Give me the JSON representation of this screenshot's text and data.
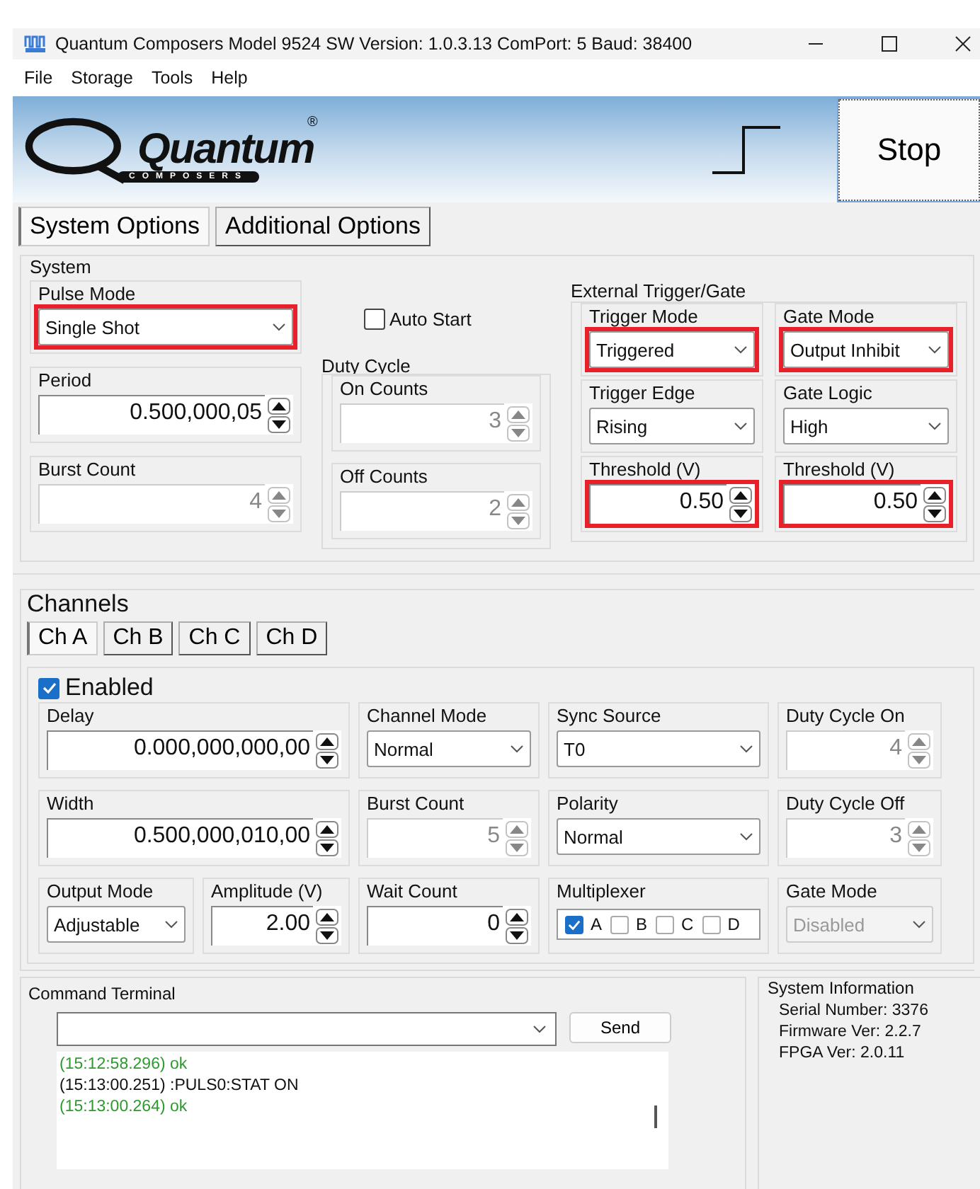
{
  "window": {
    "title": "Quantum Composers Model 9524  SW Version: 1.0.3.13 ComPort: 5 Baud: 38400"
  },
  "menu": [
    {
      "label": "File"
    },
    {
      "label": "Storage"
    },
    {
      "label": "Tools"
    },
    {
      "label": "Help"
    }
  ],
  "banner": {
    "logo": "Quantum",
    "logo_mark": "®",
    "logo_sub": "COMPOSERS",
    "stop_button": "Stop"
  },
  "tabs": [
    {
      "label": "System Options",
      "selected": true
    },
    {
      "label": "Additional Options",
      "selected": false
    }
  ],
  "system": {
    "title": "System",
    "left": [
      {
        "label": "Pulse Mode",
        "kind": "select",
        "value": "Single Shot",
        "disabled": false,
        "highlighted": true
      },
      {
        "label": "Period",
        "kind": "spin",
        "value": "0.500,000,05",
        "disabled": false,
        "highlighted": false
      },
      {
        "label": "Burst Count",
        "kind": "spin",
        "value": "4",
        "disabled": true,
        "highlighted": false
      }
    ],
    "auto_start": {
      "label": "Auto Start",
      "checked": false
    },
    "duty_cycle": {
      "title": "Duty Cycle",
      "fields": [
        {
          "label": "On Counts",
          "kind": "spin",
          "value": "3",
          "disabled": true,
          "highlighted": false
        },
        {
          "label": "Off Counts",
          "kind": "spin",
          "value": "2",
          "disabled": true,
          "highlighted": false
        }
      ]
    },
    "external": {
      "title": "External Trigger/Gate",
      "fields": [
        {
          "label": "Trigger Mode",
          "kind": "select",
          "value": "Triggered",
          "disabled": false,
          "highlighted": true
        },
        {
          "label": "Gate Mode",
          "kind": "select",
          "value": "Output Inhibit",
          "disabled": false,
          "highlighted": true
        },
        {
          "label": "Trigger Edge",
          "kind": "select",
          "value": "Rising",
          "disabled": false,
          "highlighted": false
        },
        {
          "label": "Gate Logic",
          "kind": "select",
          "value": "High",
          "disabled": false,
          "highlighted": false
        },
        {
          "label": "Threshold (V)",
          "kind": "spin",
          "value": "0.50",
          "disabled": false,
          "highlighted": true
        },
        {
          "label": "Threshold (V)",
          "kind": "spin",
          "value": "0.50",
          "disabled": false,
          "highlighted": true
        }
      ]
    }
  },
  "channels": {
    "title": "Channels",
    "tabs": [
      {
        "label": "Ch A",
        "selected": true
      },
      {
        "label": "Ch B",
        "selected": false
      },
      {
        "label": "Ch C",
        "selected": false
      },
      {
        "label": "Ch D",
        "selected": false
      }
    ],
    "enabled": {
      "label": "Enabled",
      "checked": true
    },
    "fields": [
      {
        "label": "Delay",
        "kind": "spin",
        "value": "0.000,000,000,00",
        "disabled": false,
        "highlighted": false
      },
      {
        "label": "Channel Mode",
        "kind": "select",
        "value": "Normal",
        "disabled": false,
        "highlighted": false
      },
      {
        "label": "Sync Source",
        "kind": "select",
        "value": "T0",
        "disabled": false,
        "highlighted": false
      },
      {
        "label": "Duty Cycle On",
        "kind": "spin",
        "value": "4",
        "disabled": true,
        "highlighted": false
      },
      {
        "label": "Width",
        "kind": "spin",
        "value": "0.500,000,010,00",
        "disabled": false,
        "highlighted": false
      },
      {
        "label": "Burst Count",
        "kind": "spin",
        "value": "5",
        "disabled": true,
        "highlighted": false
      },
      {
        "label": "Polarity",
        "kind": "select",
        "value": "Normal",
        "disabled": false,
        "highlighted": false
      },
      {
        "label": "Duty Cycle Off",
        "kind": "spin",
        "value": "3",
        "disabled": true,
        "highlighted": false
      },
      {
        "label": "Output Mode",
        "kind": "select",
        "value": "Adjustable",
        "disabled": false,
        "highlighted": false
      },
      {
        "label": "Amplitude (V)",
        "kind": "spin",
        "value": "2.00",
        "disabled": false,
        "highlighted": false
      },
      {
        "label": "Wait Count",
        "kind": "spin",
        "value": "0",
        "disabled": false,
        "highlighted": false
      },
      {
        "label": "Multiplexer",
        "kind": "checks",
        "options": [
          {
            "label": "A",
            "checked": true
          },
          {
            "label": "B",
            "checked": false
          },
          {
            "label": "C",
            "checked": false
          },
          {
            "label": "D",
            "checked": false
          }
        ],
        "disabled": false,
        "highlighted": false
      },
      {
        "label": "Gate Mode",
        "kind": "select",
        "value": "Disabled",
        "disabled": true,
        "highlighted": false
      }
    ]
  },
  "terminal": {
    "title": "Command Terminal",
    "send_button": "Send",
    "log": [
      {
        "kind": "response",
        "text": "(15:12:58.296) ok"
      },
      {
        "kind": "command",
        "text": "(15:13:00.251) :PULS0:STAT ON"
      },
      {
        "kind": "response",
        "text": "(15:13:00.264) ok"
      }
    ]
  },
  "system_information": {
    "title": "System Information",
    "lines": [
      "Serial Number: 3376",
      "Firmware Ver: 2.2.7",
      "FPGA Ver: 2.0.11"
    ]
  }
}
